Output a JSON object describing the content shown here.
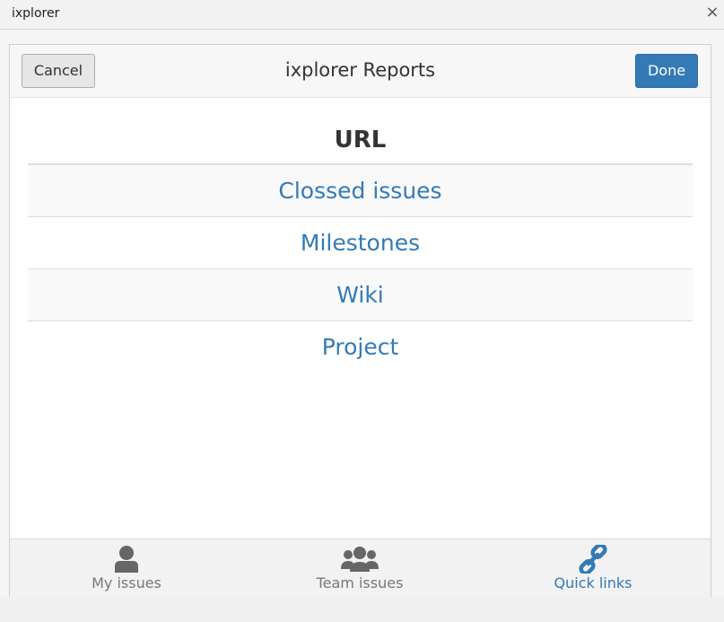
{
  "window": {
    "title": "ixplorer",
    "close_glyph": "×"
  },
  "header": {
    "title": "ixplorer Reports",
    "cancel_label": "Cancel",
    "done_label": "Done"
  },
  "table": {
    "header": "URL",
    "links": [
      "Clossed issues",
      "Milestones",
      "Wiki",
      "Project"
    ]
  },
  "footer": {
    "tabs": [
      {
        "label": "My issues",
        "icon": "user-icon",
        "active": false
      },
      {
        "label": "Team issues",
        "icon": "users-icon",
        "active": false
      },
      {
        "label": "Quick links",
        "icon": "link-icon",
        "active": true
      }
    ]
  },
  "colors": {
    "accent": "#337ab7",
    "inactive_tab": "#777777"
  }
}
